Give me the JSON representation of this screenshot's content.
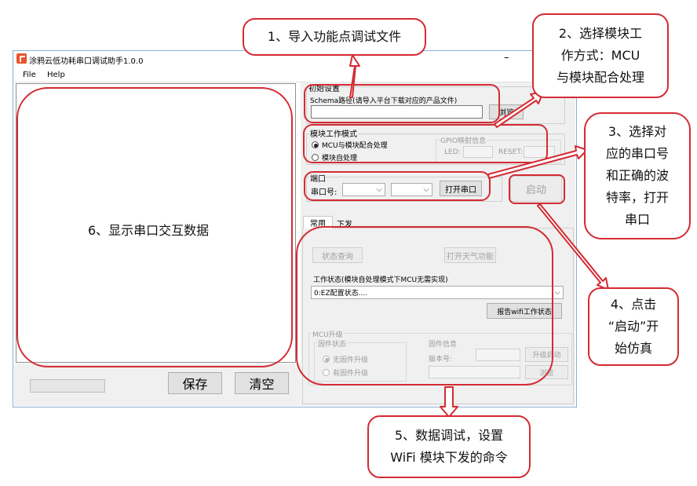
{
  "window": {
    "title": "涂鸦云低功耗串口调试助手1.0.0",
    "minimize_glyph": "–",
    "menu": [
      "File",
      "Help"
    ]
  },
  "init": {
    "group_title": "初始设置",
    "schema_label": "Schema路径(请导入平台下载对应的产品文件)",
    "schema_value": "",
    "browse_label": "浏览"
  },
  "mode": {
    "group_title": "模块工作模式",
    "options": [
      "MCU与模块配合处理",
      "模块自处理"
    ],
    "selected": 0,
    "gpio_title": "GPIO映射信息",
    "led_label": "LED:",
    "reset_label": "RESET:"
  },
  "port": {
    "group_title": "端口",
    "port_label": "串口号:",
    "open_label": "打开串口",
    "start_label": "启动"
  },
  "tabs": [
    "常用",
    "下发"
  ],
  "common": {
    "status_query_label": "状态查询",
    "weather_label": "打开天气功能",
    "work_status_label": "工作状态(模块自处理模式下MCU无需实现)",
    "work_status_value": "0:EZ配置状态....",
    "report_wifi_label": "报告wifi工作状态"
  },
  "mcu_upgrade": {
    "group_title": "MCU升级",
    "fw_status_title": "固件状态",
    "fw_options": [
      "无固件升级",
      "有固件升级"
    ],
    "fw_info_title": "固件信息",
    "version_label": "版本号:",
    "upgrade_start_label": "升级启动",
    "browse_label": "浏览"
  },
  "bottom": {
    "save_label": "保存",
    "clear_label": "清空"
  },
  "callouts": {
    "c1": "1、导入功能点调试文件",
    "c2": [
      "2、选择模块工",
      "作方式：MCU",
      "与模块配合处理"
    ],
    "c3": [
      "3、选择对",
      "应的串口号",
      "和正确的波",
      "特率，打开",
      "串口"
    ],
    "c4": [
      "4、点击",
      "“启动”开",
      "始仿真"
    ],
    "c5": [
      "5、数据调试，设置",
      "WiFi 模块下发的命令"
    ],
    "c6": "6、显示串口交互数据"
  },
  "colors": {
    "callout_border": "#d42b33",
    "window_border": "#8ab0d8",
    "panel_bg": "#f0f0f0"
  }
}
